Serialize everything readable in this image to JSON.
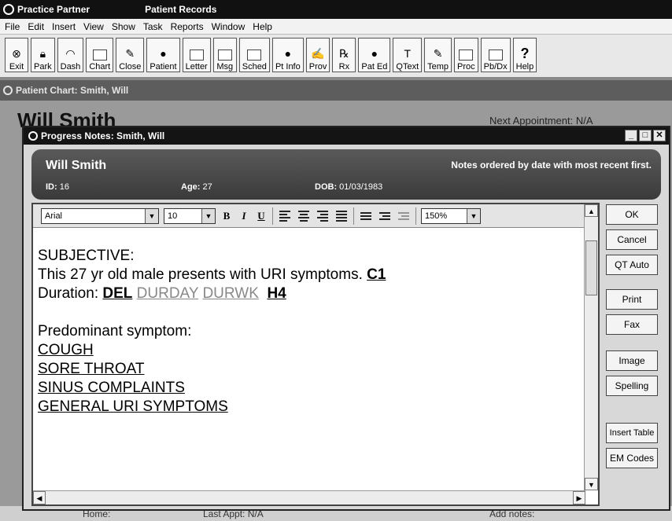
{
  "app": {
    "title": "Practice Partner",
    "subtitle": "Patient Records"
  },
  "menu": [
    "File",
    "Edit",
    "Insert",
    "View",
    "Show",
    "Task",
    "Reports",
    "Window",
    "Help"
  ],
  "toolbar": [
    {
      "label": "Exit",
      "icon": "exit-icon"
    },
    {
      "label": "Park",
      "icon": "lock-icon"
    },
    {
      "label": "Dash",
      "icon": "gauge-icon"
    },
    {
      "label": "Chart",
      "icon": "chart-icon"
    },
    {
      "label": "Close",
      "icon": "close-chart-icon"
    },
    {
      "label": "Patient",
      "icon": "person-icon"
    },
    {
      "label": "Letter",
      "icon": "letter-icon"
    },
    {
      "label": "Msg",
      "icon": "message-icon"
    },
    {
      "label": "Sched",
      "icon": "calendar-icon"
    },
    {
      "label": "Pt Info",
      "icon": "patient-info-icon"
    },
    {
      "label": "Prov",
      "icon": "provider-icon"
    },
    {
      "label": "Rx",
      "icon": "rx-icon"
    },
    {
      "label": "Pat Ed",
      "icon": "patient-education-icon"
    },
    {
      "label": "QText",
      "icon": "qtext-icon"
    },
    {
      "label": "Temp",
      "icon": "template-icon"
    },
    {
      "label": "Proc",
      "icon": "procedure-icon"
    },
    {
      "label": "Pb/Dx",
      "icon": "problem-diagnosis-icon"
    },
    {
      "label": "Help",
      "icon": "help-icon"
    }
  ],
  "chart_window": {
    "title": "Patient Chart: Smith, Will",
    "patient_name": "Will Smith",
    "next_appt": "Next Appointment: N/A"
  },
  "bg_bottom": {
    "home": "Home:",
    "last_appt": "Last Appt: N/A",
    "add_notes": "Add notes:"
  },
  "dialog": {
    "title": "Progress Notes: Smith, Will",
    "patient_name": "Will Smith",
    "order_note": "Notes ordered by date with most recent first.",
    "id_label": "ID:",
    "id_value": "16",
    "age_label": "Age:",
    "age_value": "27",
    "dob_label": "DOB:",
    "dob_value": "01/03/1983"
  },
  "format": {
    "font": "Arial",
    "size": "10",
    "zoom": "150%",
    "bold": "B",
    "italic": "I",
    "underline": "U"
  },
  "note": {
    "subjective": "SUBJECTIVE:",
    "presents_text": "This 27 yr old male presents with URI symptoms.",
    "c1": "C1",
    "duration_label": "Duration:",
    "del": "DEL",
    "durday": "DURDAY",
    "durwk": "DURWK",
    "h4": "H4",
    "predominant": "Predominant symptom:",
    "symptoms": [
      "COUGH",
      "SORE THROAT",
      "SINUS COMPLAINTS",
      "GENERAL URI SYMPTOMS"
    ]
  },
  "side_buttons": [
    "OK",
    "Cancel",
    "QT Auto",
    "Print",
    "Fax",
    "Image",
    "Spelling",
    "Insert Table",
    "EM Codes"
  ]
}
